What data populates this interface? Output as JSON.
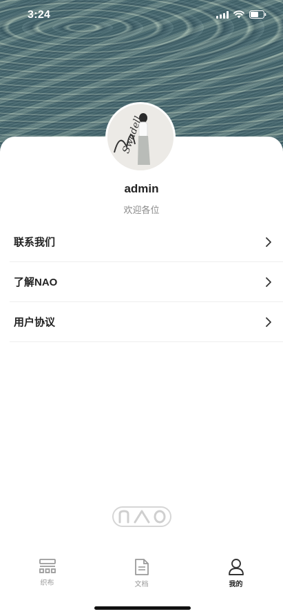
{
  "status_bar": {
    "time": "3:24"
  },
  "profile": {
    "username": "admin",
    "welcome": "欢迎各位",
    "avatar_signature": "Swadell"
  },
  "menu": {
    "items": [
      {
        "label": "联系我们",
        "icon": "chevron-right-icon"
      },
      {
        "label": "了解NAO",
        "icon": "chevron-right-icon"
      },
      {
        "label": "用户协议",
        "icon": "chevron-right-icon"
      }
    ]
  },
  "brand": {
    "logo_text": "NAO"
  },
  "tab_bar": {
    "tabs": [
      {
        "label": "织布",
        "icon": "fabric-icon",
        "active": false
      },
      {
        "label": "文档",
        "icon": "document-icon",
        "active": false
      },
      {
        "label": "我的",
        "icon": "user-icon",
        "active": true
      }
    ]
  },
  "colors": {
    "active_tab": "#222222",
    "inactive_tab": "#999999",
    "divider": "#eeeeee"
  }
}
